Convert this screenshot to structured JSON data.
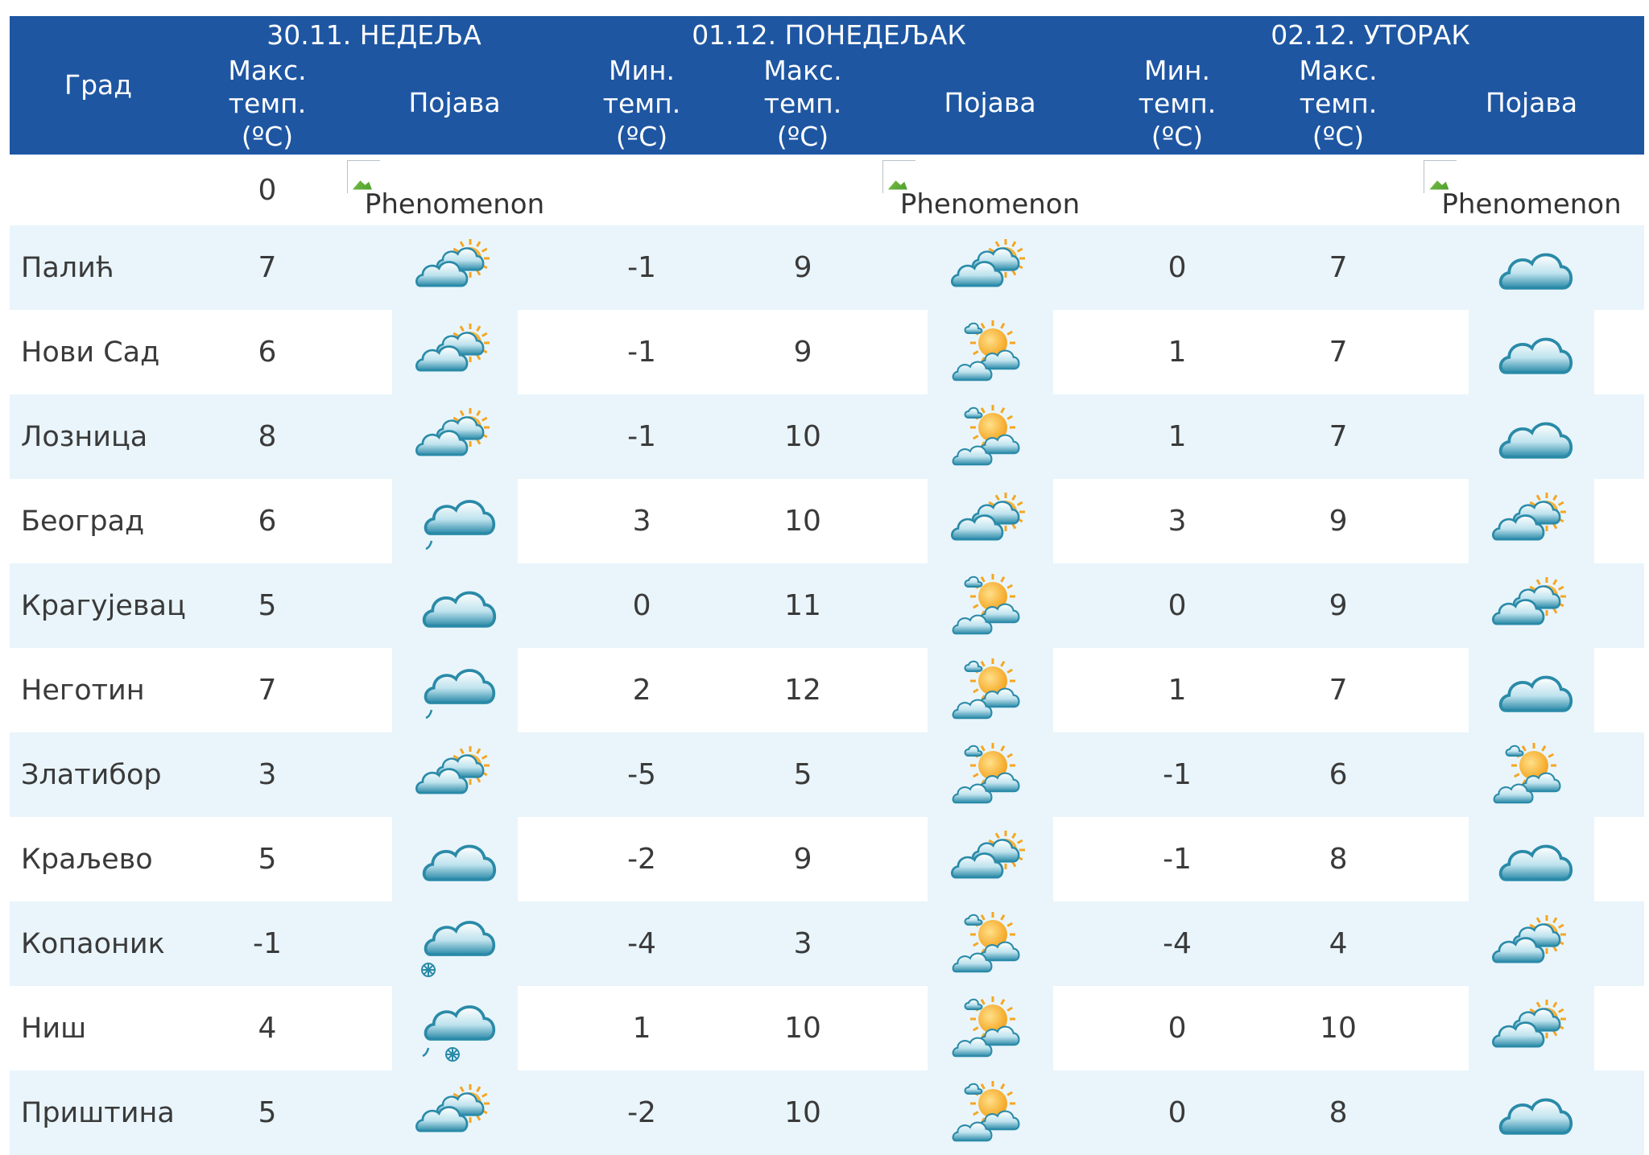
{
  "header": {
    "city_label": "Град",
    "days": [
      {
        "label": "30.11. НЕДЕЉА"
      },
      {
        "label": "01.12. ПОНЕДЕЉАК"
      },
      {
        "label": "02.12. УТОРАК"
      }
    ],
    "min_temp": [
      "Мин.",
      "темп.",
      "(ºC)"
    ],
    "max_temp": [
      "Макс.",
      "темп.",
      "(ºC)"
    ],
    "phenomenon": "Појава"
  },
  "placeholder_row": {
    "day1_max": "0",
    "image_alt": "Phenomenon"
  },
  "rows": [
    {
      "city": "Палић",
      "d1_max": "7",
      "d1_icon": "partly-cloudy-icon",
      "d2_min": "-1",
      "d2_max": "9",
      "d2_icon": "partly-cloudy-icon",
      "d3_min": "0",
      "d3_max": "7",
      "d3_icon": "cloudy-icon"
    },
    {
      "city": "Нови Сад",
      "d1_max": "6",
      "d1_icon": "partly-cloudy-icon",
      "d2_min": "-1",
      "d2_max": "9",
      "d2_icon": "mostly-sunny-icon",
      "d3_min": "1",
      "d3_max": "7",
      "d3_icon": "cloudy-icon"
    },
    {
      "city": "Лозница",
      "d1_max": "8",
      "d1_icon": "partly-cloudy-icon",
      "d2_min": "-1",
      "d2_max": "10",
      "d2_icon": "mostly-sunny-icon",
      "d3_min": "1",
      "d3_max": "7",
      "d3_icon": "cloudy-icon"
    },
    {
      "city": "Београд",
      "d1_max": "6",
      "d1_icon": "cloud-drizzle-icon",
      "d2_min": "3",
      "d2_max": "10",
      "d2_icon": "partly-cloudy-icon",
      "d3_min": "3",
      "d3_max": "9",
      "d3_icon": "partly-cloudy-icon"
    },
    {
      "city": "Крагујевац",
      "d1_max": "5",
      "d1_icon": "cloudy-icon",
      "d2_min": "0",
      "d2_max": "11",
      "d2_icon": "mostly-sunny-icon",
      "d3_min": "0",
      "d3_max": "9",
      "d3_icon": "partly-cloudy-icon"
    },
    {
      "city": "Неготин",
      "d1_max": "7",
      "d1_icon": "cloud-drizzle-icon",
      "d2_min": "2",
      "d2_max": "12",
      "d2_icon": "mostly-sunny-icon",
      "d3_min": "1",
      "d3_max": "7",
      "d3_icon": "cloudy-icon"
    },
    {
      "city": "Златибор",
      "d1_max": "3",
      "d1_icon": "partly-cloudy-icon",
      "d2_min": "-5",
      "d2_max": "5",
      "d2_icon": "mostly-sunny-icon",
      "d3_min": "-1",
      "d3_max": "6",
      "d3_icon": "mostly-sunny-icon"
    },
    {
      "city": "Краљево",
      "d1_max": "5",
      "d1_icon": "cloudy-icon",
      "d2_min": "-2",
      "d2_max": "9",
      "d2_icon": "partly-cloudy-icon",
      "d3_min": "-1",
      "d3_max": "8",
      "d3_icon": "cloudy-icon"
    },
    {
      "city": "Копаоник",
      "d1_max": "-1",
      "d1_icon": "cloud-snow-icon",
      "d2_min": "-4",
      "d2_max": "3",
      "d2_icon": "mostly-sunny-icon",
      "d3_min": "-4",
      "d3_max": "4",
      "d3_icon": "partly-cloudy-icon"
    },
    {
      "city": "Ниш",
      "d1_max": "4",
      "d1_icon": "cloud-sleet-icon",
      "d2_min": "1",
      "d2_max": "10",
      "d2_icon": "mostly-sunny-icon",
      "d3_min": "0",
      "d3_max": "10",
      "d3_icon": "partly-cloudy-icon"
    },
    {
      "city": "Приштина",
      "d1_max": "5",
      "d1_icon": "partly-cloudy-icon",
      "d2_min": "-2",
      "d2_max": "10",
      "d2_icon": "mostly-sunny-icon",
      "d3_min": "0",
      "d3_max": "8",
      "d3_icon": "cloudy-icon"
    }
  ],
  "colors": {
    "header_bg": "#1e56a2",
    "header_text": "#ffffff",
    "row_tint": "#e9f5fb",
    "cloud": "#2a8aa8",
    "sun": "#f5a623"
  }
}
